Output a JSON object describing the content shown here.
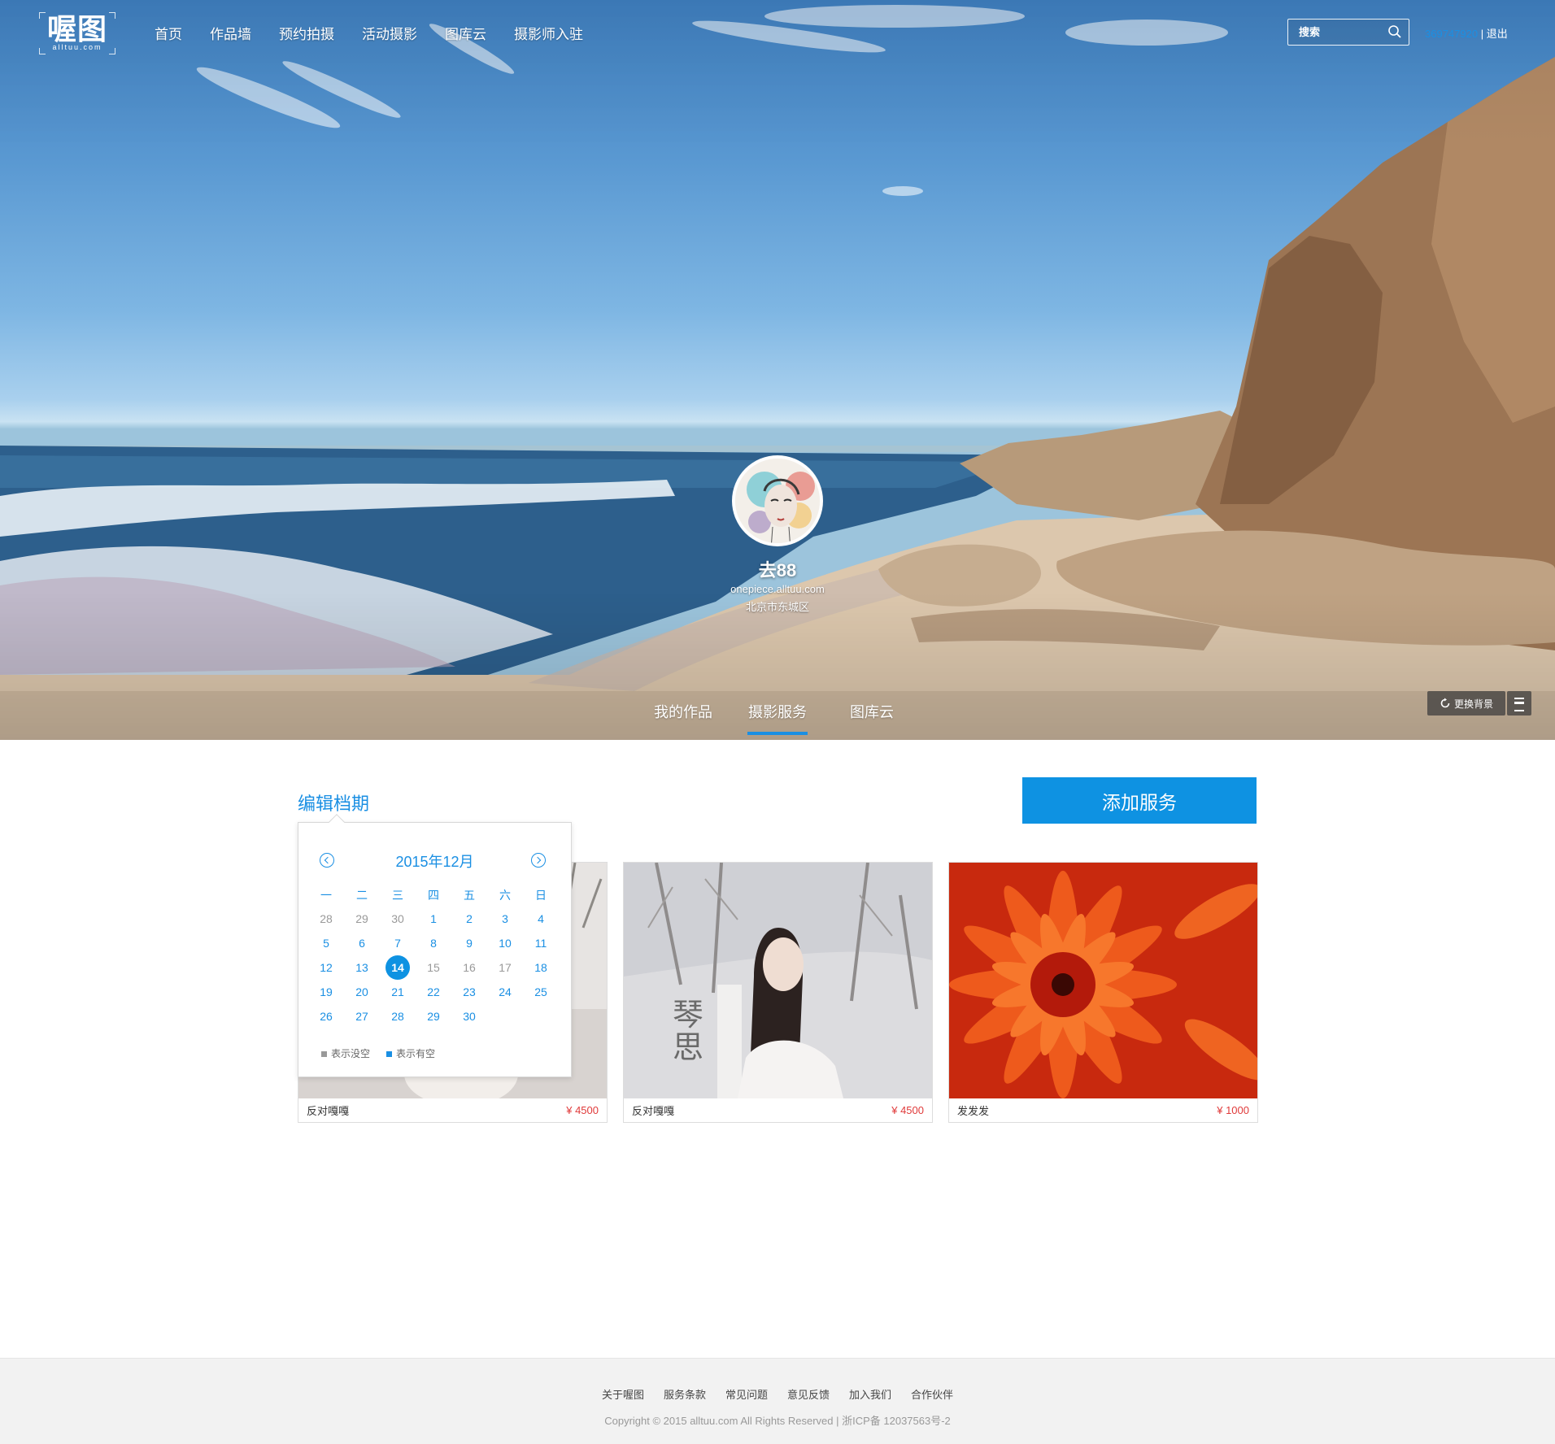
{
  "header": {
    "logo_text": "喔图",
    "logo_sub": "alltuu.com",
    "nav": [
      "首页",
      "作品墙",
      "预约拍摄",
      "活动摄影",
      "图库云",
      "摄影师入驻"
    ],
    "search_placeholder": "搜索",
    "user_id": "369747920",
    "separator": "|",
    "logout": "退出"
  },
  "profile": {
    "name": "去88",
    "site": "onepiece.alltuu.com",
    "location": "北京市东城区"
  },
  "tabs": [
    {
      "label": "我的作品",
      "active": false
    },
    {
      "label": "摄影服务",
      "active": true
    },
    {
      "label": "图库云",
      "active": false
    }
  ],
  "background_button": "更换背景",
  "section_title": "编辑档期",
  "add_service": "添加服务",
  "calendar": {
    "title": "2015年12月",
    "weekdays": [
      "一",
      "二",
      "三",
      "四",
      "五",
      "六",
      "日"
    ],
    "rows": [
      [
        {
          "d": "28",
          "m": true
        },
        {
          "d": "29",
          "m": true
        },
        {
          "d": "30",
          "m": true
        },
        {
          "d": "1"
        },
        {
          "d": "2"
        },
        {
          "d": "3"
        },
        {
          "d": "4"
        }
      ],
      [
        {
          "d": "5"
        },
        {
          "d": "6"
        },
        {
          "d": "7"
        },
        {
          "d": "8"
        },
        {
          "d": "9"
        },
        {
          "d": "10"
        },
        {
          "d": "11"
        }
      ],
      [
        {
          "d": "12"
        },
        {
          "d": "13"
        },
        {
          "d": "14",
          "today": true
        },
        {
          "d": "15",
          "m": true
        },
        {
          "d": "16",
          "m": true
        },
        {
          "d": "17",
          "m": true
        },
        {
          "d": "18"
        }
      ],
      [
        {
          "d": "19"
        },
        {
          "d": "20"
        },
        {
          "d": "21"
        },
        {
          "d": "22"
        },
        {
          "d": "23"
        },
        {
          "d": "24"
        },
        {
          "d": "25"
        }
      ],
      [
        {
          "d": "26"
        },
        {
          "d": "27"
        },
        {
          "d": "28"
        },
        {
          "d": "29"
        },
        {
          "d": "30"
        },
        {
          "d": ""
        },
        {
          "d": ""
        }
      ]
    ],
    "legend_busy": "表示没空",
    "legend_free": "表示有空",
    "busy_color": "#999999",
    "free_color": "#1a8fe3"
  },
  "services": [
    {
      "title": "反对嘎嘎",
      "price": "¥ 4500"
    },
    {
      "title": "反对嘎嘎",
      "price": "¥ 4500"
    },
    {
      "title": "发发发",
      "price": "¥ 1000"
    }
  ],
  "footer": {
    "links": [
      "关于喔图",
      "服务条款",
      "常见问题",
      "意见反馈",
      "加入我们",
      "合作伙伴"
    ],
    "copyright": "Copyright © 2015 alltuu.com All Rights Reserved | 浙ICP备 12037563号-2"
  },
  "colors": {
    "accent": "#0e92e2",
    "price": "#e03a3a"
  }
}
